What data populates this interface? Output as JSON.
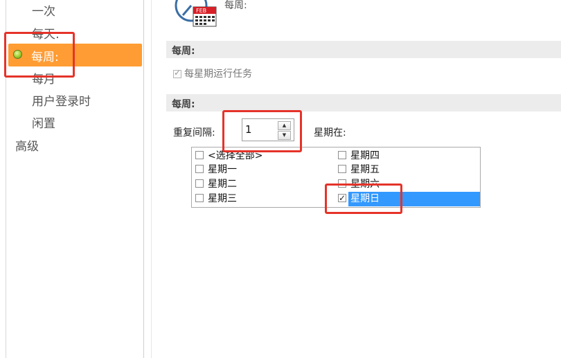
{
  "nav": {
    "items": [
      "一次",
      "每天:",
      "每周:",
      "每月",
      "用户登录时",
      "闲置",
      "高级"
    ],
    "active_index": 2
  },
  "trigger": {
    "icon": "calendar-clock-icon",
    "icon_badge": "FEB",
    "label": "每周:"
  },
  "section_weekly": {
    "title": "每周:",
    "run_every_week_label": "每星期运行任务",
    "run_every_week_checked": true
  },
  "section_schedule": {
    "title": "每周:",
    "repeat_label": "重复间隔:",
    "repeat_value": "1",
    "weekday_on_label": "星期在:",
    "days": [
      {
        "label": "<选择全部>",
        "checked": false
      },
      {
        "label": "星期一",
        "checked": false
      },
      {
        "label": "星期二",
        "checked": false
      },
      {
        "label": "星期三",
        "checked": false
      },
      {
        "label": "星期四",
        "checked": false
      },
      {
        "label": "星期五",
        "checked": false
      },
      {
        "label": "星期六",
        "checked": false
      },
      {
        "label": "星期日",
        "checked": true,
        "selected": true
      }
    ]
  },
  "colors": {
    "accent": "#ff9c33",
    "selection": "#3399ff",
    "annotation": "#e53329"
  }
}
